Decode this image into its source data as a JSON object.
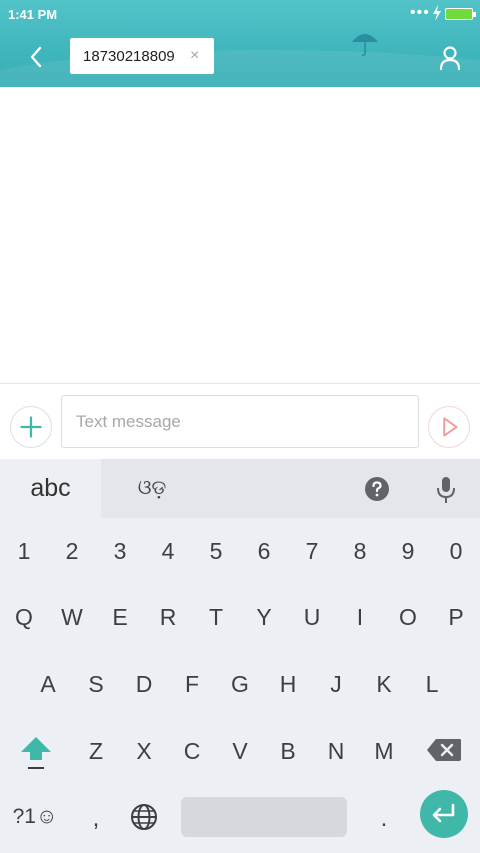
{
  "status_bar": {
    "time": "1:41 PM",
    "more": "•••",
    "battery_color": "#6fdc3c"
  },
  "header": {
    "back_icon": "chevron-left-icon",
    "recipient": "18730218809",
    "close_glyph": "×",
    "decoration_icon": "umbrella-icon",
    "contact_icon": "person-icon",
    "accent_color": "#45b9c0"
  },
  "composer": {
    "add_icon": "plus-icon",
    "placeholder": "Text message",
    "value": "",
    "send_icon": "send-icon"
  },
  "keyboard": {
    "tab_abc": "abc",
    "tab_script": "ଓଡ଼",
    "help_icon": "question-icon",
    "mic_icon": "microphone-icon",
    "row_numbers": [
      "1",
      "2",
      "3",
      "4",
      "5",
      "6",
      "7",
      "8",
      "9",
      "0"
    ],
    "row_q": [
      "Q",
      "W",
      "E",
      "R",
      "T",
      "Y",
      "U",
      "I",
      "O",
      "P"
    ],
    "row_a": [
      "A",
      "S",
      "D",
      "F",
      "G",
      "H",
      "J",
      "K",
      "L"
    ],
    "row_z": [
      "Z",
      "X",
      "C",
      "V",
      "B",
      "N",
      "M"
    ],
    "shift_icon": "shift-arrow-icon",
    "delete_icon": "backspace-icon",
    "symbols_label": "?1☺",
    "comma": ",",
    "globe_icon": "globe-icon",
    "period": ".",
    "enter_icon": "enter-icon",
    "enter_color": "#3fb8a9"
  }
}
